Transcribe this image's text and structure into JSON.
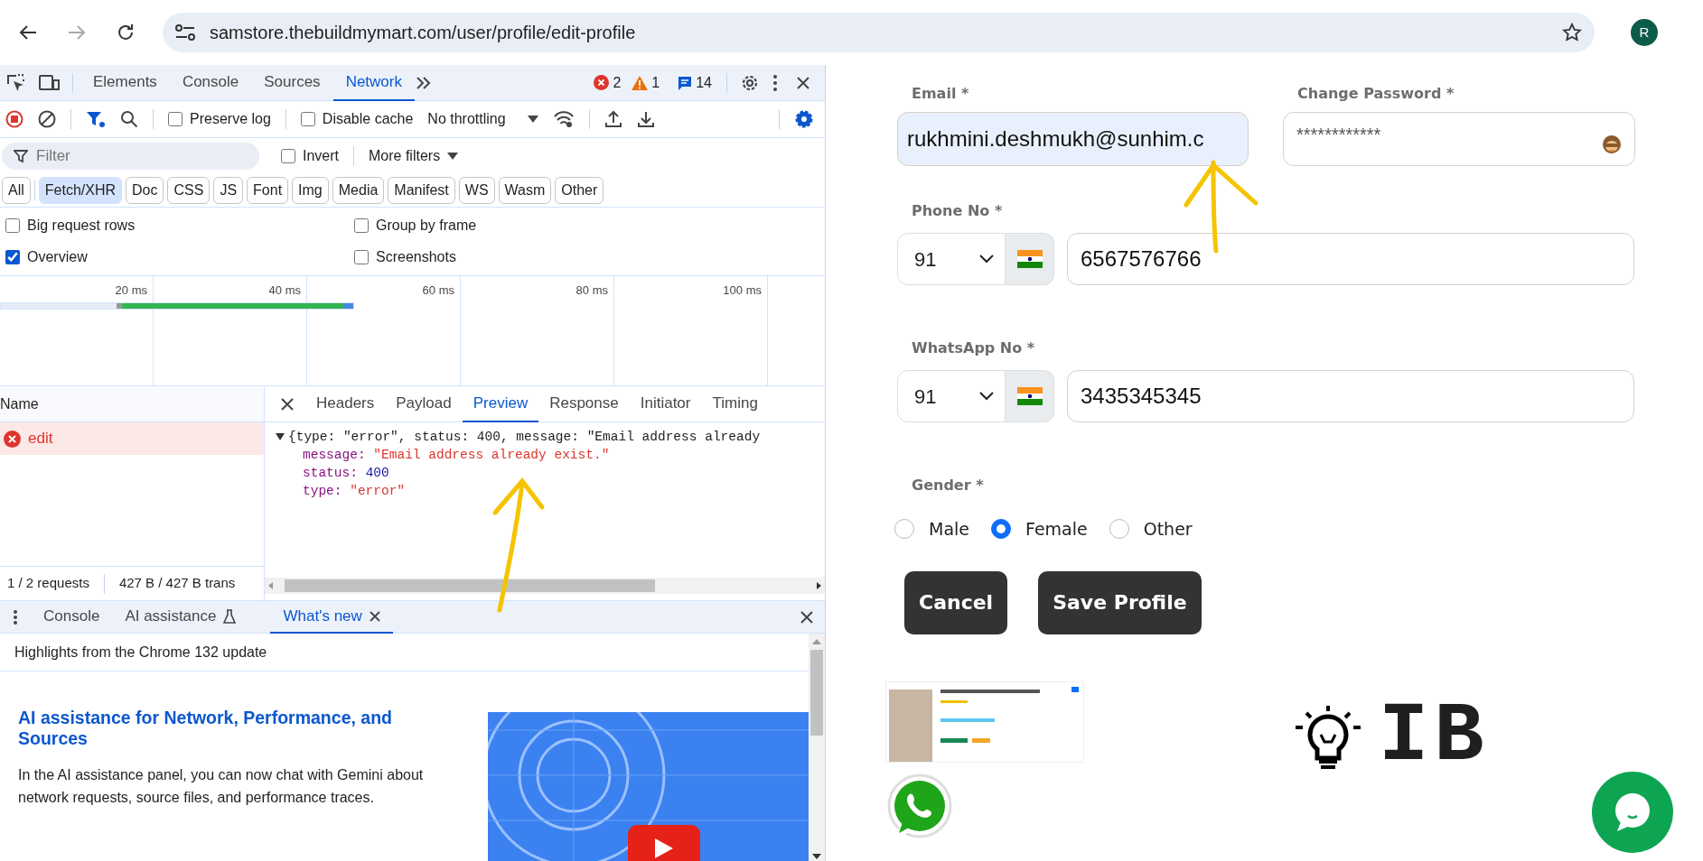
{
  "browser": {
    "url": "samstore.thebuildmymart.com/user/profile/edit-profile",
    "profile_initial": "R"
  },
  "devtools": {
    "tabs": [
      {
        "label": "Elements",
        "selected": false
      },
      {
        "label": "Console",
        "selected": false
      },
      {
        "label": "Sources",
        "selected": false
      },
      {
        "label": "Network",
        "selected": true
      }
    ],
    "counts": {
      "errors": "2",
      "warnings": "1",
      "messages": "14"
    },
    "toolbar": {
      "checks": [
        {
          "label": "Preserve log",
          "checked": false
        },
        {
          "label": "Disable cache",
          "checked": false
        }
      ],
      "throttling": "No throttling"
    },
    "filter": {
      "placeholder": "Filter",
      "invert": {
        "label": "Invert",
        "checked": false
      },
      "more_filters": "More filters"
    },
    "type_filters": [
      {
        "label": "All",
        "selected": false
      },
      {
        "label": "Fetch/XHR",
        "selected": true
      },
      {
        "label": "Doc",
        "selected": false
      },
      {
        "label": "CSS",
        "selected": false
      },
      {
        "label": "JS",
        "selected": false
      },
      {
        "label": "Font",
        "selected": false
      },
      {
        "label": "Img",
        "selected": false
      },
      {
        "label": "Media",
        "selected": false
      },
      {
        "label": "Manifest",
        "selected": false
      },
      {
        "label": "WS",
        "selected": false
      },
      {
        "label": "Wasm",
        "selected": false
      },
      {
        "label": "Other",
        "selected": false
      }
    ],
    "options": [
      {
        "label": "Big request rows",
        "checked": false
      },
      {
        "label": "Group by frame",
        "checked": false
      },
      {
        "label": "Overview",
        "checked": true
      },
      {
        "label": "Screenshots",
        "checked": false
      }
    ],
    "timeline": {
      "ticks": [
        "20 ms",
        "40 ms",
        "60 ms",
        "80 ms",
        "100 ms"
      ]
    },
    "requests": {
      "column": "Name",
      "rows": [
        {
          "name": "edit",
          "error": true,
          "selected": true
        }
      ],
      "summary": [
        "1 / 2 requests",
        "427 B / 427 B trans"
      ]
    },
    "detail_tabs": [
      {
        "label": "Headers",
        "selected": false
      },
      {
        "label": "Payload",
        "selected": false
      },
      {
        "label": "Preview",
        "selected": true
      },
      {
        "label": "Response",
        "selected": false
      },
      {
        "label": "Initiator",
        "selected": false
      },
      {
        "label": "Timing",
        "selected": false
      }
    ],
    "preview": {
      "summary": "{type: \"error\", status: 400, message: \"Email address already",
      "expanded": true,
      "properties": [
        {
          "label": "message:",
          "value": "\"Email address already exist.\"",
          "kind": "string"
        },
        {
          "label": "status:",
          "value": "400",
          "kind": "number"
        },
        {
          "label": "type:",
          "value": "\"error\"",
          "kind": "string"
        }
      ]
    },
    "drawer": {
      "tabs": [
        {
          "label": "Console",
          "selected": false,
          "kind": "plain"
        },
        {
          "label": "AI assistance",
          "selected": false,
          "kind": "experiment"
        },
        {
          "label": "What's new",
          "selected": true,
          "kind": "closable"
        }
      ],
      "heading": "Highlights from the Chrome 132 update",
      "article": {
        "title": "AI assistance for Network, Performance, and Sources",
        "body": "In the AI assistance panel, you can now chat with Gemini about network requests, source files, and performance traces."
      }
    }
  },
  "form": {
    "email": {
      "label": "Email *",
      "value": "rukhmini.deshmukh@sunhim.c"
    },
    "password": {
      "label": "Change Password *",
      "value": "************"
    },
    "phones": [
      {
        "label": "Phone No *",
        "code": "91",
        "number": "6567576766"
      },
      {
        "label": "WhatsApp No *",
        "code": "91",
        "number": "3435345345"
      }
    ],
    "gender": {
      "label": "Gender *",
      "options": [
        {
          "label": "Male",
          "selected": false
        },
        {
          "label": "Female",
          "selected": true
        },
        {
          "label": "Other",
          "selected": false
        }
      ]
    },
    "buttons": [
      {
        "label": "Cancel"
      },
      {
        "label": "Save Profile"
      }
    ]
  },
  "logo": {
    "text": "IB"
  }
}
